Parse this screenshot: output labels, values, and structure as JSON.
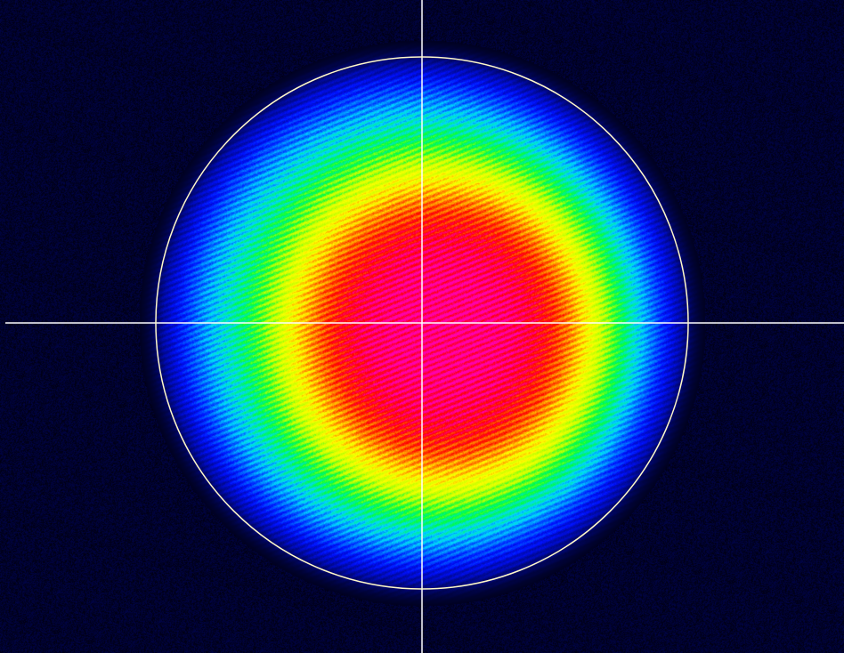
{
  "viewer": {
    "colormap": [
      "#000010",
      "#0010ff",
      "#00d8ff",
      "#00ff40",
      "#c8ff00",
      "#ffff00",
      "#ff8000",
      "#ff0000",
      "#ff00b0"
    ],
    "overlay_color": "#ffffff",
    "fit_circle_color": "#fff8c8",
    "crosshair_color": "#ffffff",
    "icons": {
      "crosshair": "crosshair-icon",
      "fit_circle": "fit-circle-icon"
    }
  }
}
